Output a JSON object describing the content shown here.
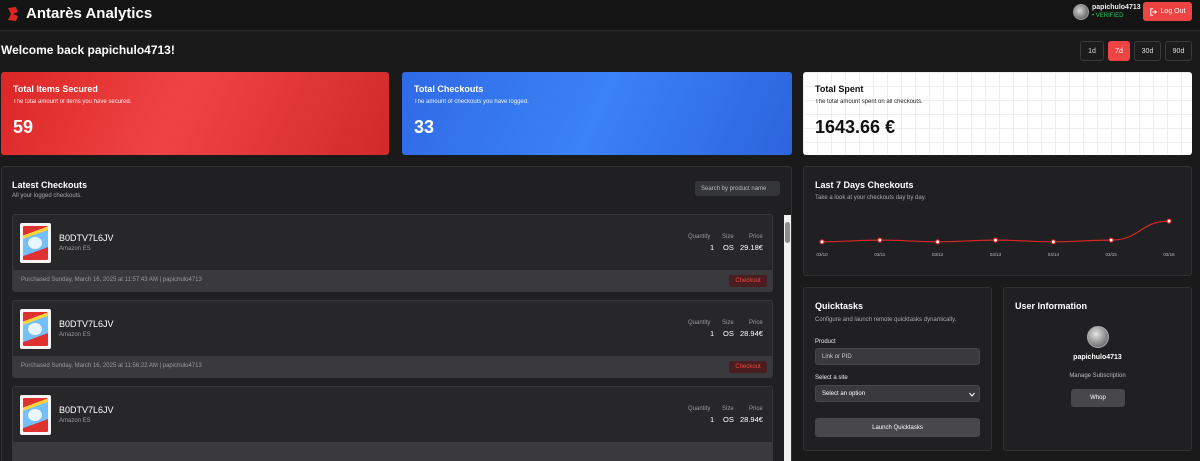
{
  "app": {
    "title": "Antarès Analytics"
  },
  "header": {
    "username": "papichulo4713",
    "verified": "• VERIFIED",
    "logout_label": "Log Out"
  },
  "welcome": "Welcome back papichulo4713!",
  "ranges": [
    "1d",
    "7d",
    "30d",
    "90d"
  ],
  "active_range": "7d",
  "stats": [
    {
      "title": "Total Items Secured",
      "desc": "The total amount of items you have secured.",
      "value": "59"
    },
    {
      "title": "Total Checkouts",
      "desc": "The amount of checkouts you have logged.",
      "value": "33"
    },
    {
      "title": "Total Spent",
      "desc": "The total amount spent on all checkouts.",
      "value": "1643.66 €"
    }
  ],
  "latest": {
    "title": "Latest Checkouts",
    "subtitle": "All your logged checkouts.",
    "search_placeholder": "Search by product name",
    "col_quantity": "Quantity",
    "col_size": "Size",
    "col_price": "Price",
    "orders": [
      {
        "pid": "B0DTV7L6JV",
        "store": "Amazon ES",
        "quantity": "1",
        "size": "OS",
        "price": "29.18€",
        "date": "Purchased Sunday, March 16, 2025 at 11:57:43 AM | papichulo4713",
        "badge": "Checkout"
      },
      {
        "pid": "B0DTV7L6JV",
        "store": "Amazon ES",
        "quantity": "1",
        "size": "OS",
        "price": "28.94€",
        "date": "Purchased Sunday, March 16, 2025 at 11:56:22 AM | papichulo4713",
        "badge": "Checkout"
      },
      {
        "pid": "B0DTV7L6JV",
        "store": "Amazon ES",
        "quantity": "1",
        "size": "OS",
        "price": "28.94€",
        "date": "",
        "badge": ""
      }
    ]
  },
  "chart_panel": {
    "title": "Last 7 Days Checkouts",
    "subtitle": "Take a look at your checkouts day by day."
  },
  "chart_data": {
    "type": "line",
    "categories": [
      "03/10",
      "03/11",
      "03/12",
      "03/13",
      "03/14",
      "03/15",
      "03/16"
    ],
    "values": [
      3,
      4,
      3,
      4,
      3,
      4,
      15
    ],
    "ylim": [
      0,
      22
    ],
    "color": "#dc2626",
    "grid": false
  },
  "quicktasks": {
    "title": "Quicktasks",
    "subtitle": "Configure and launch remote quicktasks dynamically.",
    "product_label": "Product",
    "product_placeholder": "Link or PID",
    "site_label": "Select a site",
    "site_selected": "Select an option",
    "launch_label": "Launch Quicktasks"
  },
  "user_info": {
    "title": "User Information",
    "username": "papichulo4713",
    "manage_label": "Manage Subscription",
    "whop_label": "Whop"
  },
  "colors": {
    "accent": "#ef4444",
    "blue": "#3b82f6",
    "verified": "#22c55e"
  }
}
